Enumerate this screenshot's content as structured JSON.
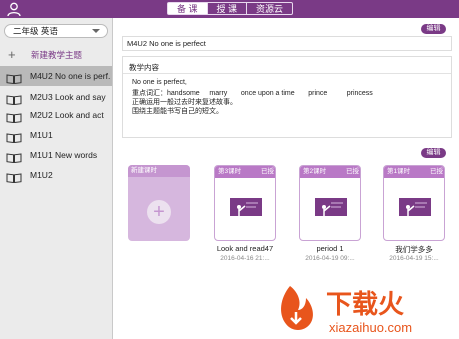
{
  "topbar": {
    "tabs": [
      {
        "label": "备 课",
        "active": true
      },
      {
        "label": "授 课",
        "active": false
      },
      {
        "label": "资源云",
        "active": false
      }
    ]
  },
  "sidebar": {
    "grade_select": "二年级 英语",
    "new_topic_label": "新建教学主题",
    "items": [
      {
        "label": "M4U2 No one is perf...",
        "active": true
      },
      {
        "label": "M2U3 Look and say"
      },
      {
        "label": "M2U2 Look and act"
      },
      {
        "label": "M1U1"
      },
      {
        "label": "M1U1 New words"
      },
      {
        "label": "M1U2"
      }
    ]
  },
  "main": {
    "edit_label": "编辑",
    "title_value": "M4U2 No one is perfect",
    "content_heading": "教学内容",
    "content_lines": [
      "No one is perfect,",
      "重点词汇：handsome     marry       once upon a time       prince          princess",
      "正确运用一般过去时来复述故事。",
      "围绕主题能书写自己的短文。"
    ],
    "new_lesson_label": "新建课时",
    "lessons": [
      {
        "num": "第3课时",
        "status": "已授",
        "title": "Look and read47",
        "date": "2016-04-16 21:..."
      },
      {
        "num": "第2课时",
        "status": "已授",
        "title": "period 1",
        "date": "2016-04-19 09:..."
      },
      {
        "num": "第1课时",
        "status": "已授",
        "title": "我们学多多",
        "date": "2016-04-19 15:..."
      }
    ]
  },
  "watermark": {
    "brand": "下载火",
    "url": "xiazaihuo.com"
  },
  "colors": {
    "accent": "#7a3a86",
    "card_header": "#b979c6",
    "board": "#7a3a86",
    "watermark": "#e8551c"
  },
  "icons": [
    "user-icon",
    "plus-icon",
    "book-icon",
    "chevron-down-icon",
    "blackboard-teacher-icon"
  ]
}
